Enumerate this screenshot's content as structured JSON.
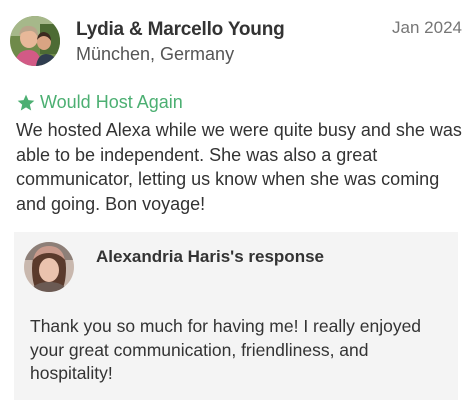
{
  "review": {
    "reviewer_name": "Lydia & Marcello  Young",
    "reviewer_location": "München, Germany",
    "date": "Jan 2024",
    "recommendation": {
      "icon": "star-icon",
      "label": "Would Host Again",
      "color": "#4caf72"
    },
    "text": "We hosted Alexa while we were quite busy and she was able to be independent. She was also a great communicator, letting us know when she was coming and going. Bon voyage!"
  },
  "response": {
    "title": "Alexandria Haris's response",
    "text": "Thank you so much for having me! I really enjoyed your great communication, friendliness, and hospitality!",
    "background": "#f4f4f4"
  }
}
